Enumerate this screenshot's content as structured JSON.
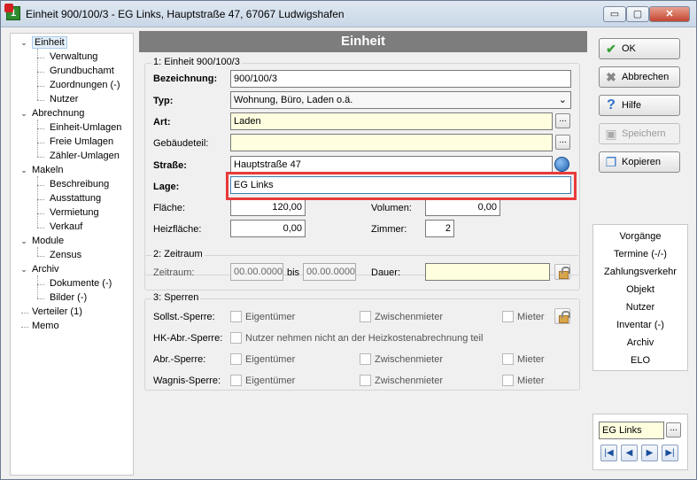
{
  "window": {
    "title": "Einheit 900/100/3 - EG Links, Hauptstraße 47, 67067 Ludwigshafen",
    "controls": {
      "minimize": "▭",
      "maximize": "▢",
      "close": "✕"
    }
  },
  "tree": {
    "items": [
      {
        "label": "Einheit",
        "level": 0,
        "expanded": true,
        "selected": true
      },
      {
        "label": "Verwaltung",
        "level": 1
      },
      {
        "label": "Grundbuchamt",
        "level": 1
      },
      {
        "label": "Zuordnungen (-)",
        "level": 1
      },
      {
        "label": "Nutzer",
        "level": 1
      },
      {
        "label": "Abrechnung",
        "level": 0,
        "expanded": true
      },
      {
        "label": "Einheit-Umlagen",
        "level": 1
      },
      {
        "label": "Freie Umlagen",
        "level": 1
      },
      {
        "label": "Zähler-Umlagen",
        "level": 1
      },
      {
        "label": "Makeln",
        "level": 0,
        "expanded": true
      },
      {
        "label": "Beschreibung",
        "level": 1
      },
      {
        "label": "Ausstattung",
        "level": 1
      },
      {
        "label": "Vermietung",
        "level": 1
      },
      {
        "label": "Verkauf",
        "level": 1
      },
      {
        "label": "Module",
        "level": 0,
        "expanded": true
      },
      {
        "label": "Zensus",
        "level": 1
      },
      {
        "label": "Archiv",
        "level": 0,
        "expanded": true
      },
      {
        "label": "Dokumente (-)",
        "level": 1
      },
      {
        "label": "Bilder (-)",
        "level": 1
      },
      {
        "label": "Verteiler (1)",
        "level": 0
      },
      {
        "label": "Memo",
        "level": 0
      }
    ]
  },
  "main": {
    "header": "Einheit",
    "group1": {
      "title": "1: Einheit 900/100/3",
      "bezeichnung_label": "Bezeichnung:",
      "bezeichnung_value": "900/100/3",
      "typ_label": "Typ:",
      "typ_value": "Wohnung, Büro, Laden o.ä.",
      "art_label": "Art:",
      "art_value": "Laden",
      "gebaeudeteil_label": "Gebäudeteil:",
      "gebaeudeteil_value": "",
      "strasse_label": "Straße:",
      "strasse_value": "Hauptstraße 47",
      "lage_label": "Lage:",
      "lage_value": "EG Links",
      "flaeche_label": "Fläche:",
      "flaeche_value": "120,00",
      "volumen_label": "Volumen:",
      "volumen_value": "0,00",
      "heizflaeche_label": "Heizfläche:",
      "heizflaeche_value": "0,00",
      "zimmer_label": "Zimmer:",
      "zimmer_value": "2",
      "dots": "..."
    },
    "group2": {
      "title": "2: Zeitraum",
      "zeitraum_label": "Zeitraum:",
      "from_value": "00.00.0000",
      "bis_label": "bis",
      "to_value": "00.00.0000",
      "dauer_label": "Dauer:",
      "dauer_value": ""
    },
    "group3": {
      "title": "3: Sperren",
      "rows": [
        {
          "label": "Sollst.-Sperre:",
          "a": "Eigentümer",
          "b": "Zwischenmieter",
          "c": "Mieter"
        },
        {
          "label": "HK-Abr.-Sperre:",
          "wide": "Nutzer nehmen nicht an der Heizkostenabrechnung teil"
        },
        {
          "label": "Abr.-Sperre:",
          "a": "Eigentümer",
          "b": "Zwischenmieter",
          "c": "Mieter"
        },
        {
          "label": "Wagnis-Sperre:",
          "a": "Eigentümer",
          "b": "Zwischenmieter",
          "c": "Mieter"
        }
      ]
    }
  },
  "buttons": {
    "ok": "OK",
    "abbrechen": "Abbrechen",
    "hilfe": "Hilfe",
    "speichern": "Speichern",
    "kopieren": "Kopieren"
  },
  "side_links": [
    "Vorgänge",
    "Termine (-/-)",
    "Zahlungsverkehr",
    "Objekt",
    "Nutzer",
    "Inventar (-)",
    "Archiv",
    "ELO"
  ],
  "record_nav": {
    "value": "EG Links",
    "dots": "...",
    "first": "|◀",
    "prev": "◀",
    "next": "▶",
    "last": "▶|"
  },
  "colors": {
    "header_bg": "#7d7d7d",
    "highlight": "#e83a3a",
    "required_field": "#ffffe0",
    "ok_icon": "#3aa23a"
  }
}
